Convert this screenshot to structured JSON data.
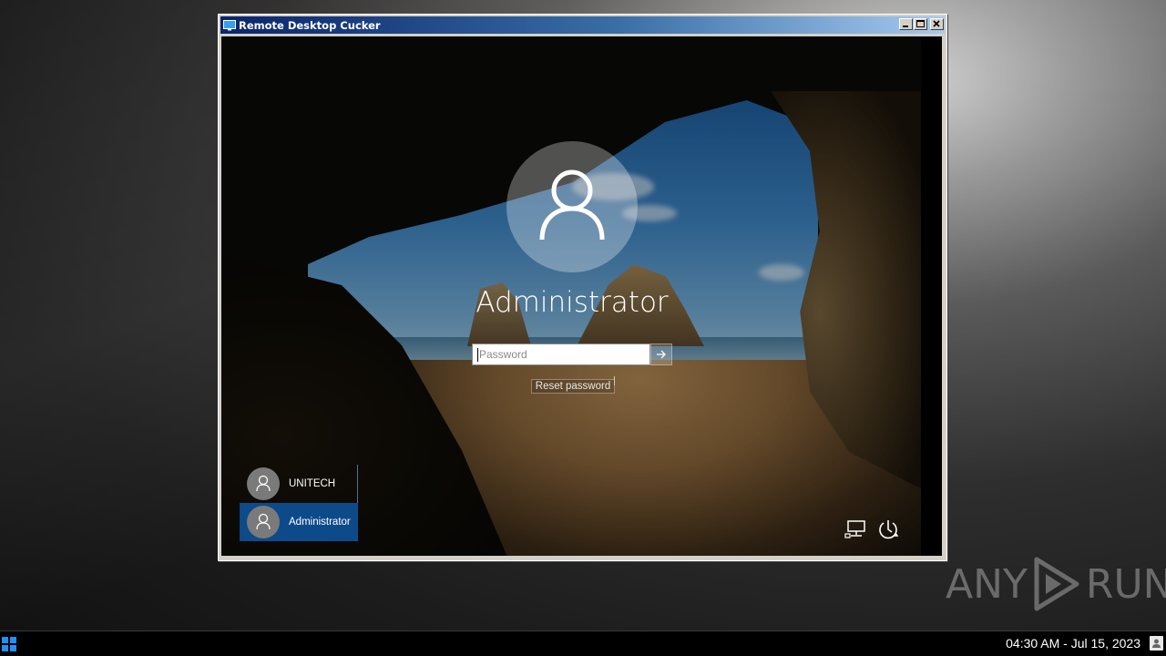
{
  "window": {
    "title": "Remote Desktop Cucker",
    "icon": "monitor-icon",
    "buttons": [
      "minimize-icon",
      "maximize-icon",
      "close-icon"
    ]
  },
  "login": {
    "user_name": "Administrator",
    "password_placeholder": "Password",
    "password_value": "",
    "submit_icon": "arrow-right-icon",
    "reset_password_label": "Reset password"
  },
  "user_list": [
    {
      "label": "UNITECH",
      "selected": false
    },
    {
      "label": "Administrator",
      "selected": true
    }
  ],
  "corner_icons": [
    "network-icon",
    "power-icon"
  ],
  "watermark": {
    "left": "ANY",
    "right": "RUN"
  },
  "taskbar": {
    "start_icon": "windows-logo-icon",
    "clock": "04:30 AM - Jul 15, 2023",
    "tray_icon": "notification-icon"
  },
  "colors": {
    "selected_tile": "#0d4a8a",
    "title_gradient_start": "#0a246a",
    "start_blue": "#1e90ff"
  }
}
